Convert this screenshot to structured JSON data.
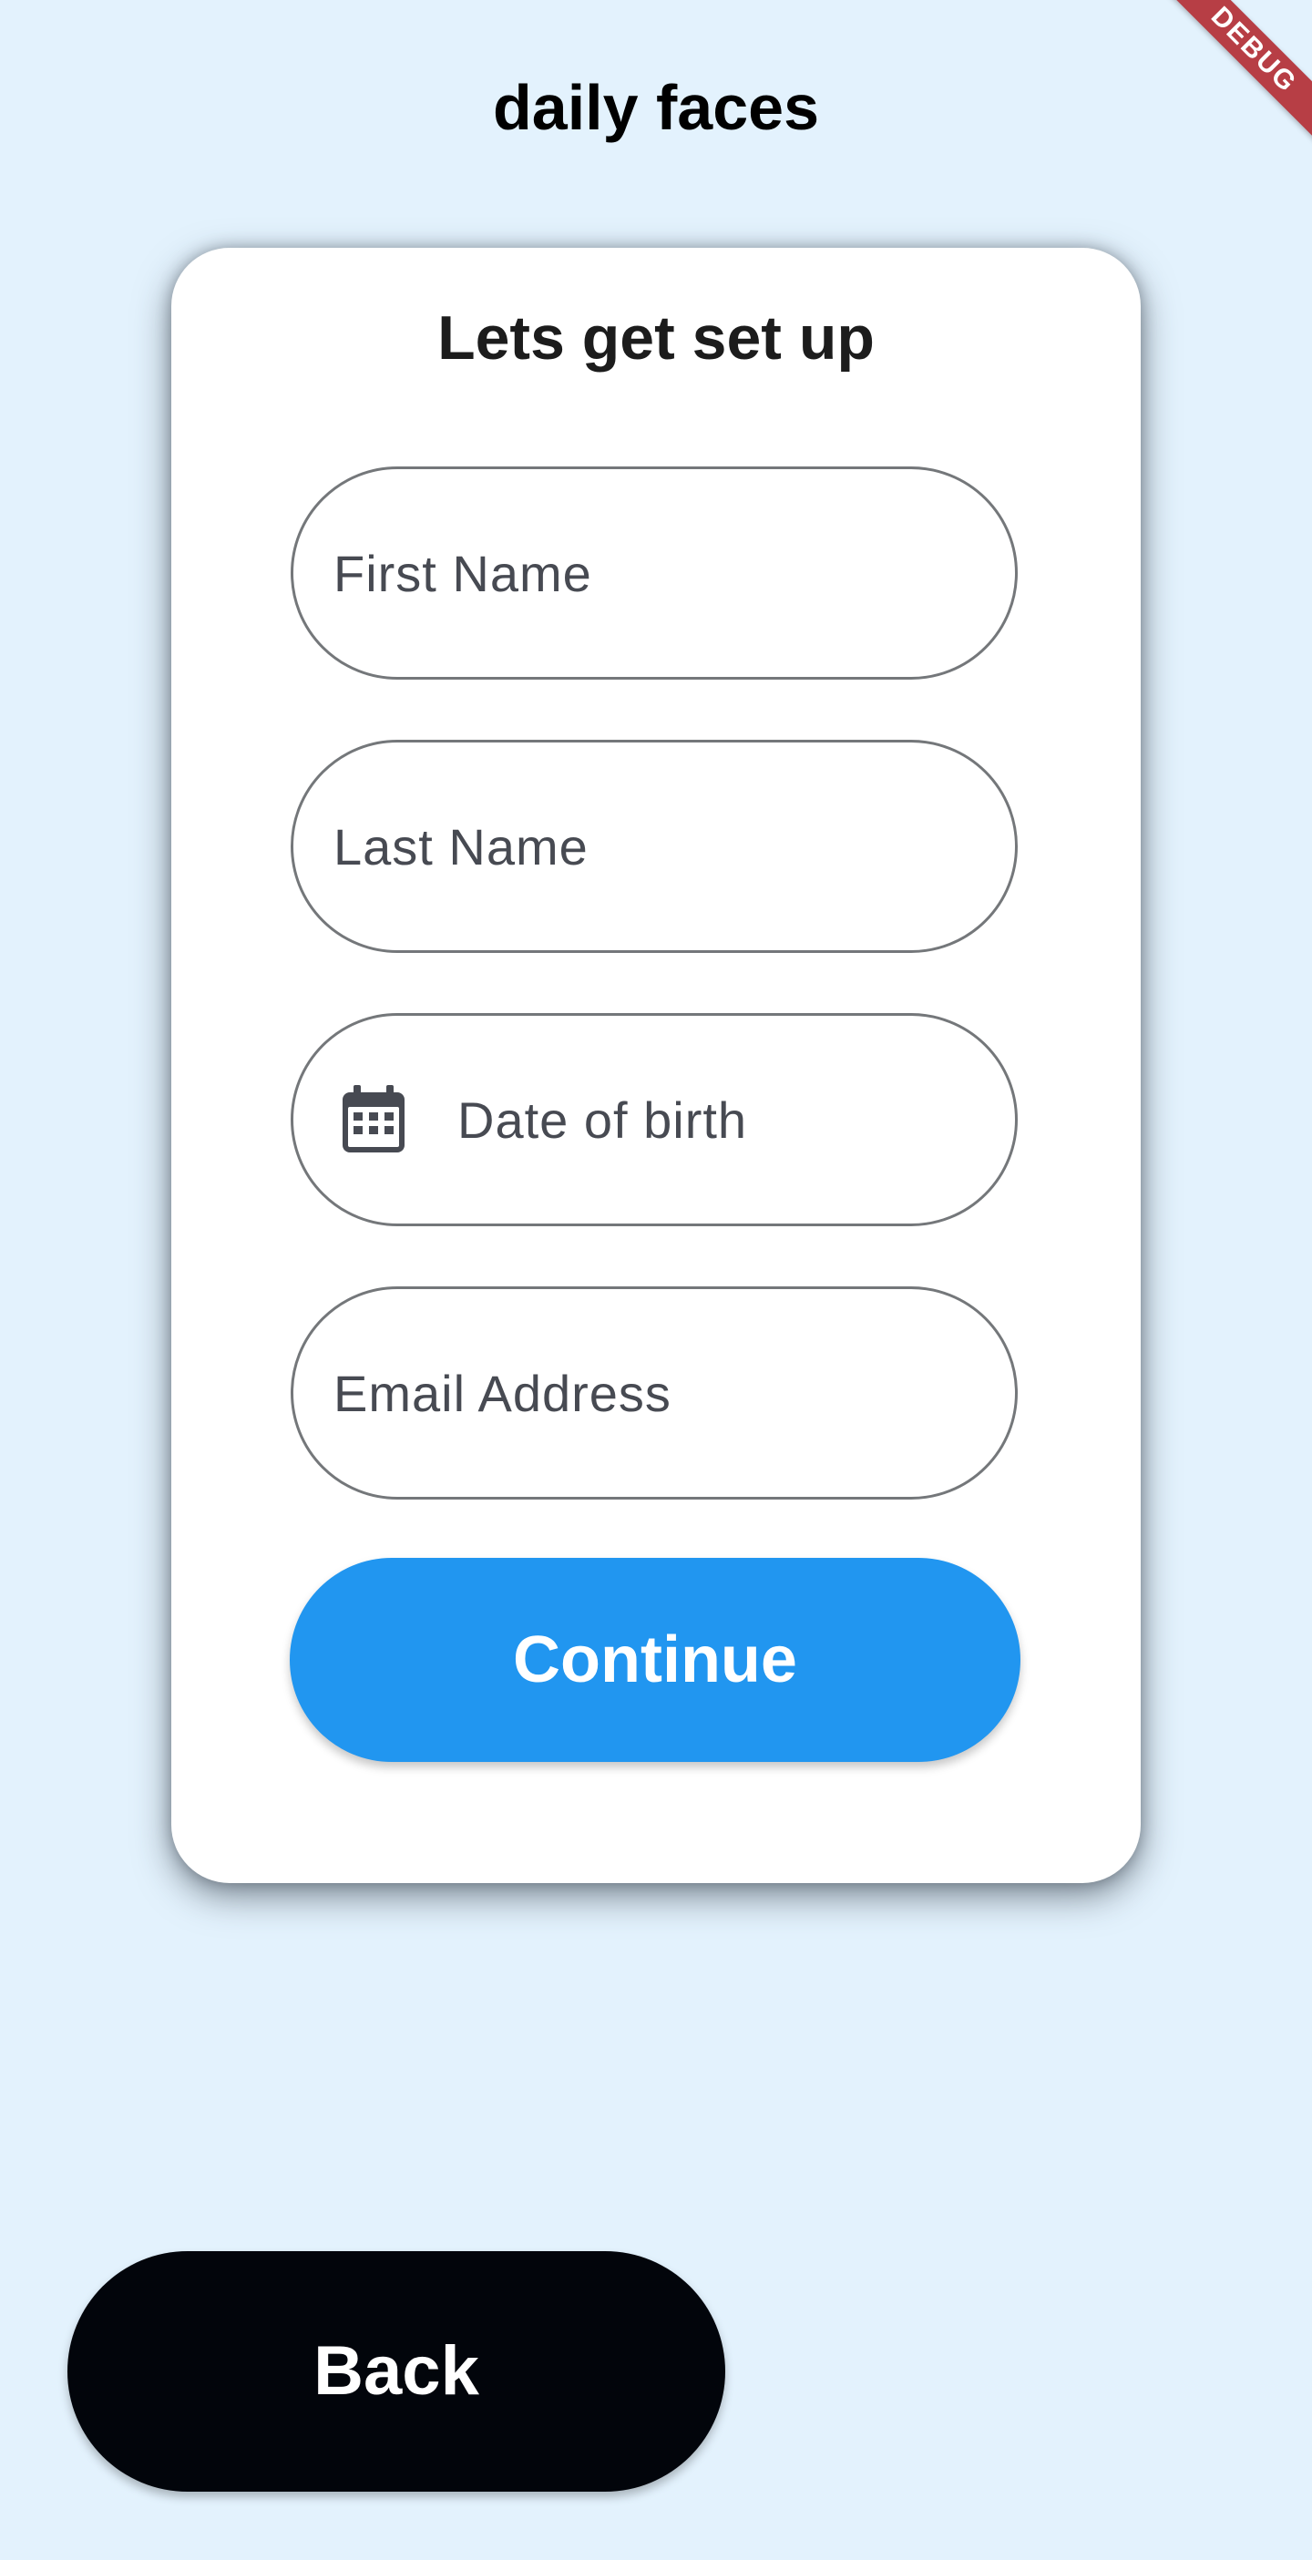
{
  "app": {
    "title": "daily faces",
    "debug_banner": "DEBUG"
  },
  "card": {
    "title": "Lets get set up",
    "fields": {
      "first_name": {
        "placeholder": "First Name",
        "value": ""
      },
      "last_name": {
        "placeholder": "Last Name",
        "value": ""
      },
      "date_of_birth": {
        "placeholder": "Date of birth",
        "value": "",
        "icon": "calendar-icon"
      },
      "email": {
        "placeholder": "Email Address",
        "value": ""
      }
    },
    "continue_label": "Continue"
  },
  "footer": {
    "back_label": "Back"
  },
  "colors": {
    "background": "#e3f2fd",
    "card": "#ffffff",
    "primary": "#2196f0",
    "back_button": "#02050b",
    "field_border": "#74777a",
    "placeholder_text": "#474a52",
    "debug_banner": "#b73e45"
  }
}
